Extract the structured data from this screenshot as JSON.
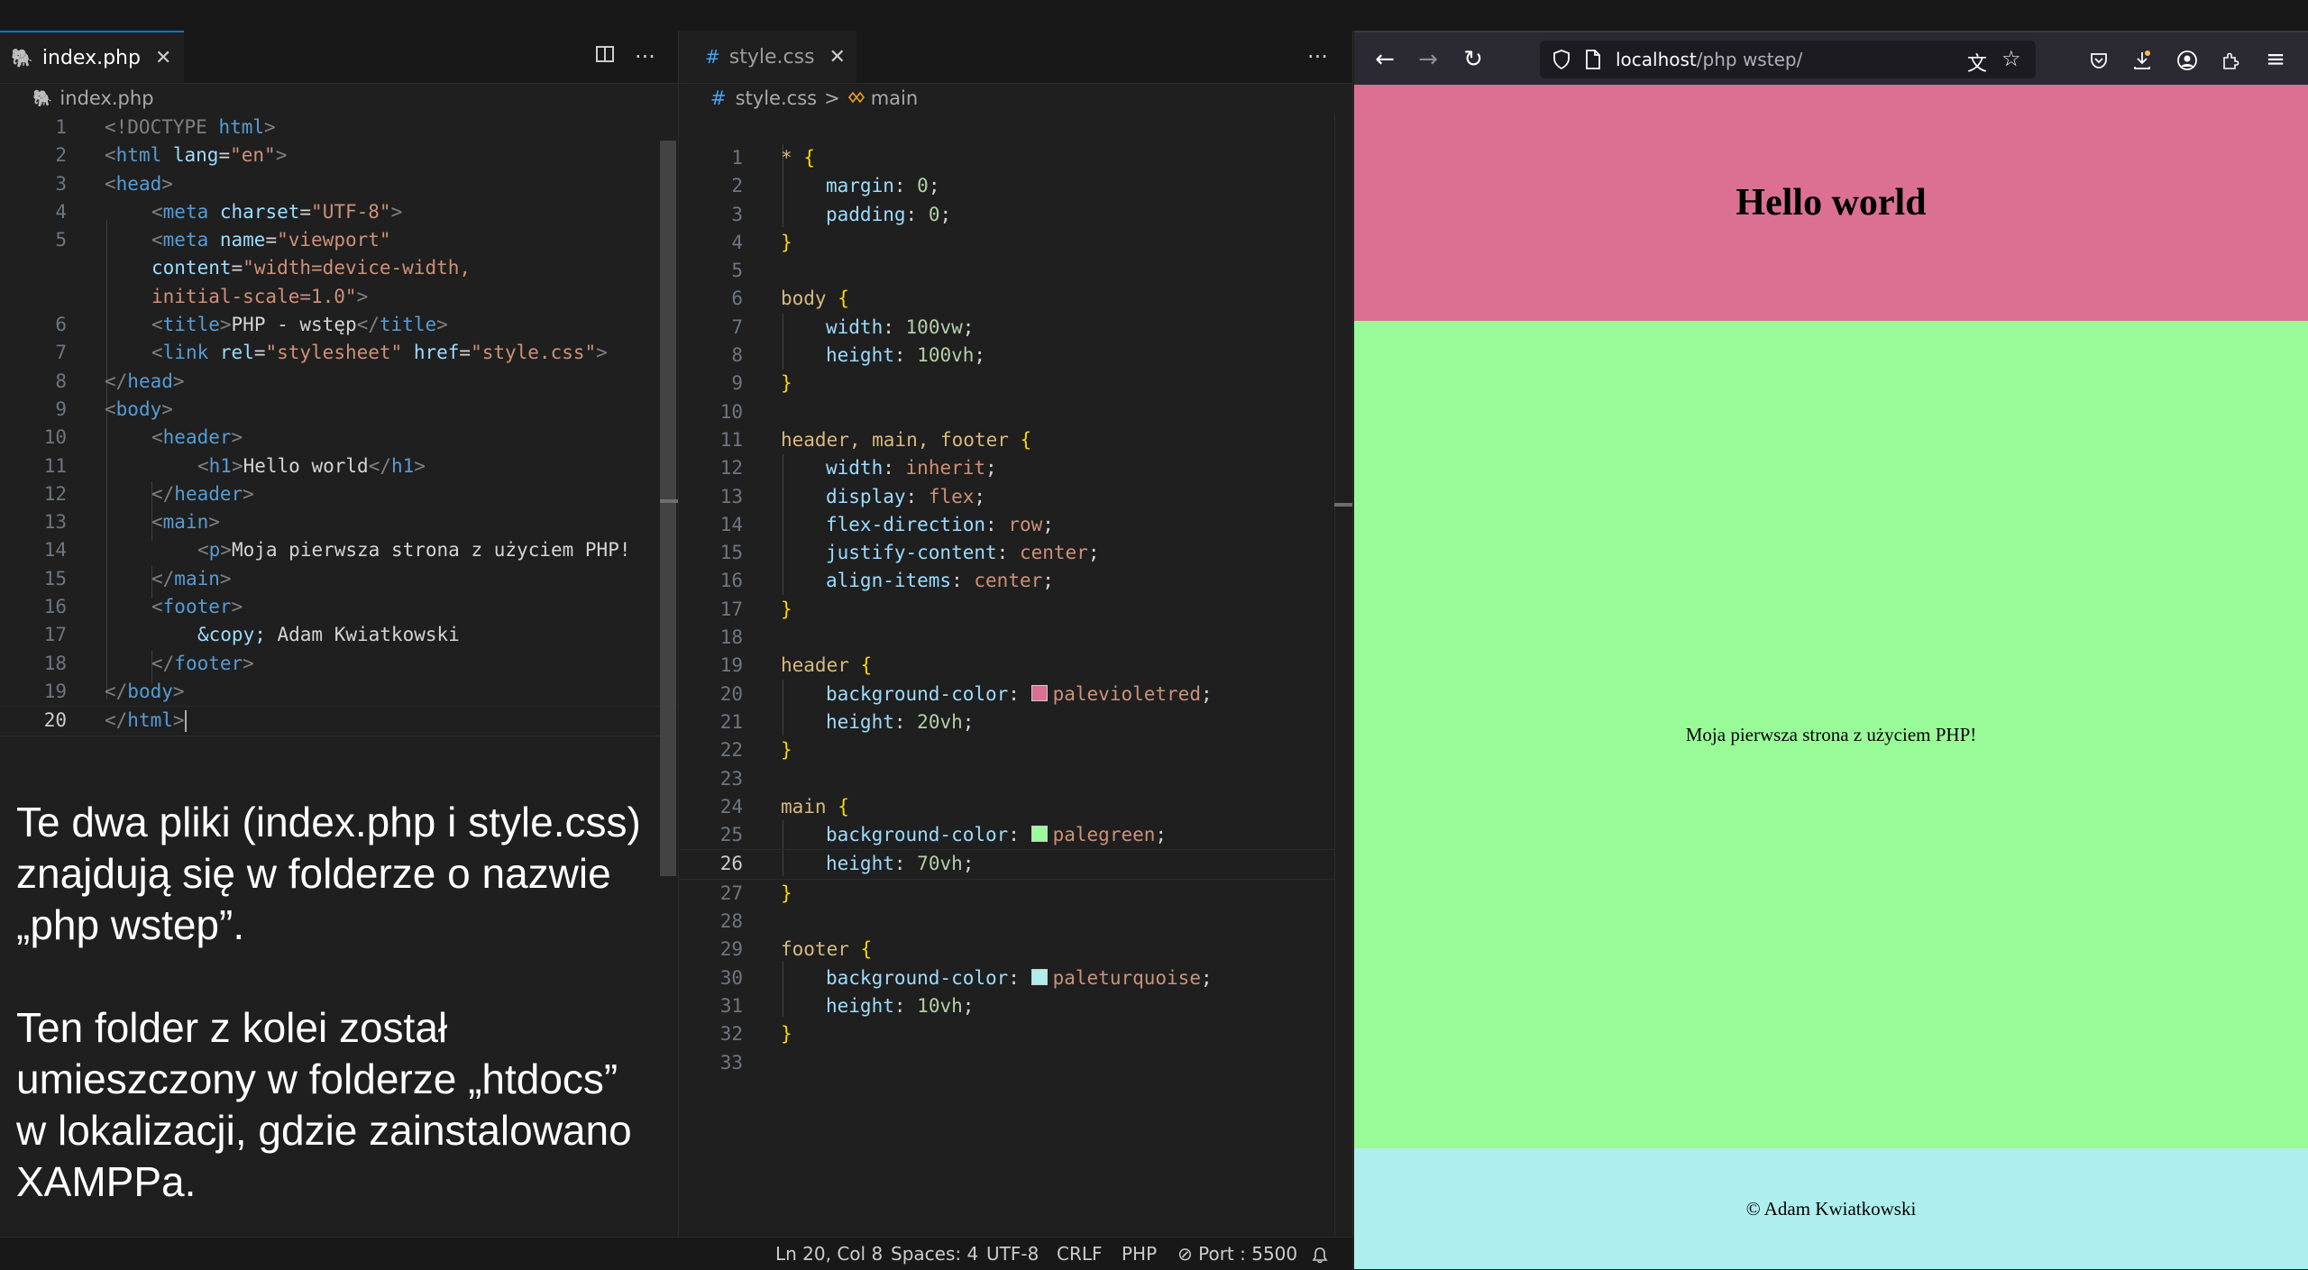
{
  "left_editor": {
    "tab_label": "index.php",
    "tab_close": "✕",
    "breadcrumb": "index.php",
    "split_icon": "split-editor-icon",
    "more_label": "···",
    "current_line": "20",
    "lines": [
      {
        "n": "1"
      },
      {
        "n": "2"
      },
      {
        "n": "3"
      },
      {
        "n": "4"
      },
      {
        "n": "5"
      },
      {
        "n": ""
      },
      {
        "n": ""
      },
      {
        "n": "6"
      },
      {
        "n": "7"
      },
      {
        "n": "8"
      },
      {
        "n": "9"
      },
      {
        "n": "10"
      },
      {
        "n": "11"
      },
      {
        "n": "12"
      },
      {
        "n": "13"
      },
      {
        "n": "14"
      },
      {
        "n": "15"
      },
      {
        "n": "16"
      },
      {
        "n": "17"
      },
      {
        "n": "18"
      },
      {
        "n": "19"
      },
      {
        "n": "20"
      }
    ],
    "code": {
      "l1_a": "<!DOCTYPE ",
      "l1_b": "html",
      "l1_c": ">",
      "l2_a": "<",
      "l2_b": "html",
      "l2_c": " lang",
      "l2_d": "=",
      "l2_e": "\"en\"",
      "l2_f": ">",
      "l3_a": "<",
      "l3_b": "head",
      "l3_c": ">",
      "l4_a": "<",
      "l4_b": "meta",
      "l4_c": " charset",
      "l4_d": "=",
      "l4_e": "\"UTF-8\"",
      "l4_f": ">",
      "l5_a": "<",
      "l5_b": "meta",
      "l5_c": " name",
      "l5_d": "=",
      "l5_e": "\"viewport\"",
      "l5b_a": "content",
      "l5b_b": "=",
      "l5b_c": "\"width=device-width,",
      "l5c_a": "initial-scale=1.0\"",
      "l5c_b": ">",
      "l6_a": "<",
      "l6_b": "title",
      "l6_c": ">",
      "l6_d": "PHP - wstęp",
      "l6_e": "</",
      "l6_f": "title",
      "l6_g": ">",
      "l7_a": "<",
      "l7_b": "link",
      "l7_c": " rel",
      "l7_d": "=",
      "l7_e": "\"stylesheet\"",
      "l7_f": " href",
      "l7_g": "=",
      "l7_h": "\"style.css\"",
      "l7_i": ">",
      "l8_a": "</",
      "l8_b": "head",
      "l8_c": ">",
      "l9_a": "<",
      "l9_b": "body",
      "l9_c": ">",
      "l10_a": "<",
      "l10_b": "header",
      "l10_c": ">",
      "l11_a": "<",
      "l11_b": "h1",
      "l11_c": ">",
      "l11_d": "Hello world",
      "l11_e": "</",
      "l11_f": "h1",
      "l11_g": ">",
      "l12_a": "</",
      "l12_b": "header",
      "l12_c": ">",
      "l13_a": "<",
      "l13_b": "main",
      "l13_c": ">",
      "l14_a": "<",
      "l14_b": "p",
      "l14_c": ">",
      "l14_d": "Moja pierwsza strona z użyciem PHP!",
      "l15_a": "</",
      "l15_b": "main",
      "l15_c": ">",
      "l16_a": "<",
      "l16_b": "footer",
      "l16_c": ">",
      "l17_a": "&copy;",
      "l17_b": " Adam Kwiatkowski",
      "l18_a": "</",
      "l18_b": "footer",
      "l18_c": ">",
      "l19_a": "</",
      "l19_b": "body",
      "l19_c": ">",
      "l20_a": "</",
      "l20_b": "html",
      "l20_c": ">"
    }
  },
  "mid_editor": {
    "tab_icon": "#",
    "tab_label": "style.css",
    "tab_close": "✕",
    "more_label": "···",
    "breadcrumb_file": "style.css",
    "breadcrumb_sep": ">",
    "breadcrumb_symbol": "main",
    "current_line": "26",
    "line_numbers": [
      "1",
      "2",
      "3",
      "4",
      "5",
      "6",
      "7",
      "8",
      "9",
      "10",
      "11",
      "12",
      "13",
      "14",
      "15",
      "16",
      "17",
      "18",
      "19",
      "20",
      "21",
      "22",
      "23",
      "24",
      "25",
      "26",
      "27",
      "28",
      "29",
      "30",
      "31",
      "32",
      "33"
    ],
    "code": {
      "sel_star": "*",
      "ob": "{",
      "cb": "}",
      "margin": "margin",
      "padding": "padding",
      "colon": ":",
      "semi": ";",
      "zero": "0",
      "body": "body",
      "width": "width",
      "height": "height",
      "v100vw": "100vw",
      "v100vh": "100vh",
      "sel_hmf": "header, main, footer",
      "inherit": "inherit",
      "display": "display",
      "flex": "flex",
      "flex_direction": "flex-direction",
      "row": "row",
      "justify_content": "justify-content",
      "center": "center",
      "align_items": "align-items",
      "header": "header",
      "background_color": "background-color",
      "palevioletred": "palevioletred",
      "v20vh": "20vh",
      "main": "main",
      "palegreen": "palegreen",
      "v70vh": "70vh",
      "footer": "footer",
      "paleturquoise": "paleturquoise",
      "v10vh": "10vh"
    },
    "swatches": {
      "palevioletred": "#db7093",
      "palegreen": "#98fb98",
      "paleturquoise": "#afeeee"
    }
  },
  "note": {
    "p1": "Te dwa pliki (index.php i style.css) znajdują się w folderze o nazwie „php wstep”.",
    "p2": "Ten folder z kolei został umieszczony w folderze „htdocs” w lokalizacji, gdzie zainstalowano XAMPPa."
  },
  "statusbar": {
    "position": "Ln 20, Col 8",
    "spaces": "Spaces: 4",
    "encoding": "UTF-8",
    "eol": "CRLF",
    "language": "PHP",
    "port": "Port : 5500"
  },
  "browser": {
    "url_host": "localhost",
    "url_path": "/php wstep/",
    "page": {
      "h1": "Hello world",
      "main_text": "Moja pierwsza strona z użyciem PHP!",
      "footer_text": "© Adam Kwiatkowski"
    },
    "colors": {
      "header": "#db7093",
      "main": "#98fb98",
      "footer": "#afeeee"
    }
  }
}
